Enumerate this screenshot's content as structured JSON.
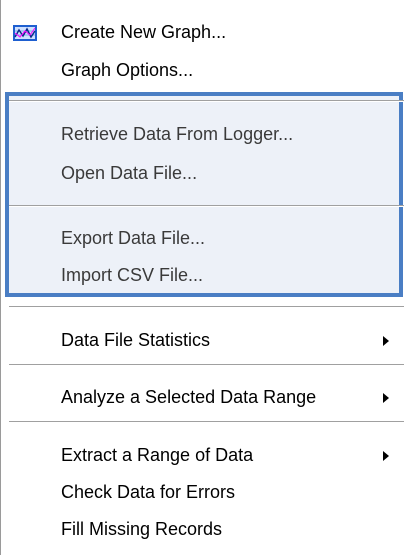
{
  "menu": {
    "items": [
      {
        "label": "Create New Graph...",
        "icon": "graph-icon"
      },
      {
        "label": "Graph Options..."
      },
      {
        "label": "Retrieve Data From Logger..."
      },
      {
        "label": "Open Data File..."
      },
      {
        "label": "Export Data File..."
      },
      {
        "label": "Import CSV File..."
      },
      {
        "label": "Data File Statistics",
        "submenu": true
      },
      {
        "label": "Analyze a Selected Data Range",
        "submenu": true
      },
      {
        "label": "Extract a Range of Data",
        "submenu": true
      },
      {
        "label": "Check Data for Errors"
      },
      {
        "label": "Fill Missing Records"
      }
    ]
  },
  "colors": {
    "highlight_border": "#4a7ec4",
    "highlight_fill": "#edf1f8"
  }
}
